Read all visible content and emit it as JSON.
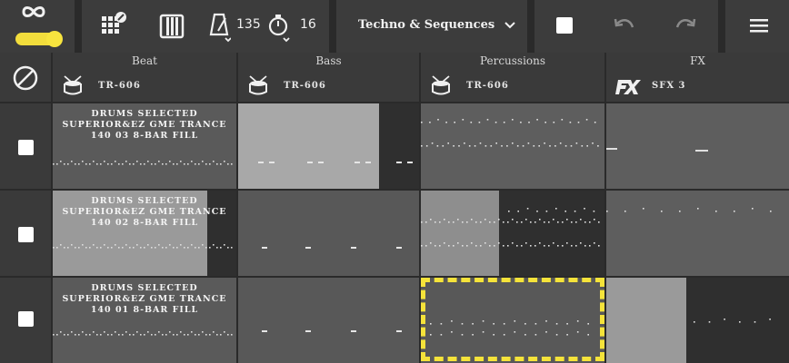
{
  "toolbar": {
    "tempo": "135",
    "steps": "16",
    "preset": "Techno & Sequences",
    "icons": [
      "loop-icon",
      "pad-grid-icon",
      "piano-icon",
      "metronome-icon",
      "timer-icon",
      "stop-icon",
      "undo-icon",
      "redo-icon",
      "menu-icon"
    ],
    "accent": "#f5e33a"
  },
  "columns": [
    {
      "title": "Beat",
      "instrument": "TR-606"
    },
    {
      "title": "Bass",
      "instrument": "TR-606"
    },
    {
      "title": "Percussions",
      "instrument": "TR-606"
    },
    {
      "title": "FX",
      "instrument": "SFX 3"
    }
  ],
  "rows": [
    {
      "beat_text": "DRUMS SELECTED\nSUPERIOR&EZ GME TRANCE\n140 03 8-BAR FILL"
    },
    {
      "beat_text": "DRUMS SELECTED\nSUPERIOR&EZ GME TRANCE\n140 02 8-BAR FILL"
    },
    {
      "beat_text": "DRUMS SELECTED\nSUPERIOR&EZ GME TRANCE\n140 01 8-BAR FILL"
    }
  ]
}
